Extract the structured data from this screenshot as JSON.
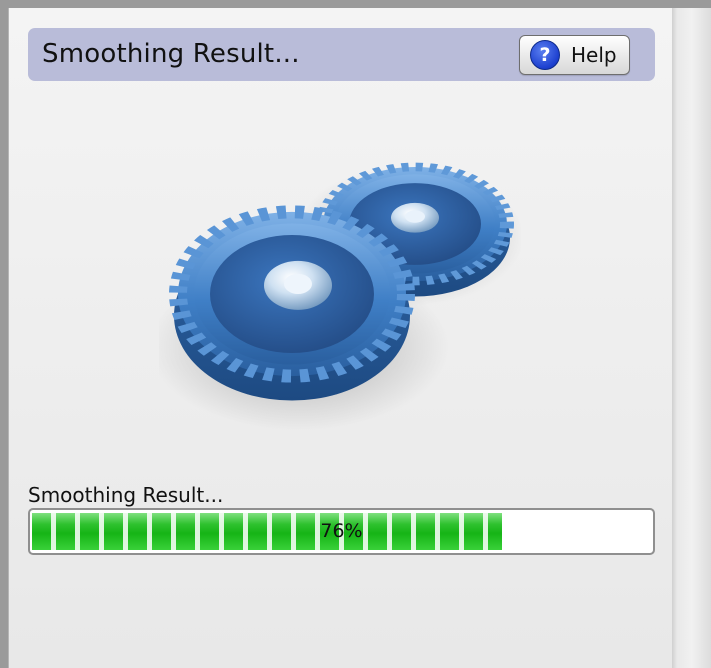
{
  "dialog": {
    "title": "Smoothing Result...",
    "help_label": "Help",
    "help_icon": "question-mark-icon",
    "header_color": "#b9bcd9"
  },
  "illustration": {
    "icon": "gears-icon",
    "color": "#3d6fae"
  },
  "progress": {
    "label": "Smoothing Result...",
    "percent": 76,
    "percent_text": "76%",
    "fill_color": "#22bb22"
  }
}
